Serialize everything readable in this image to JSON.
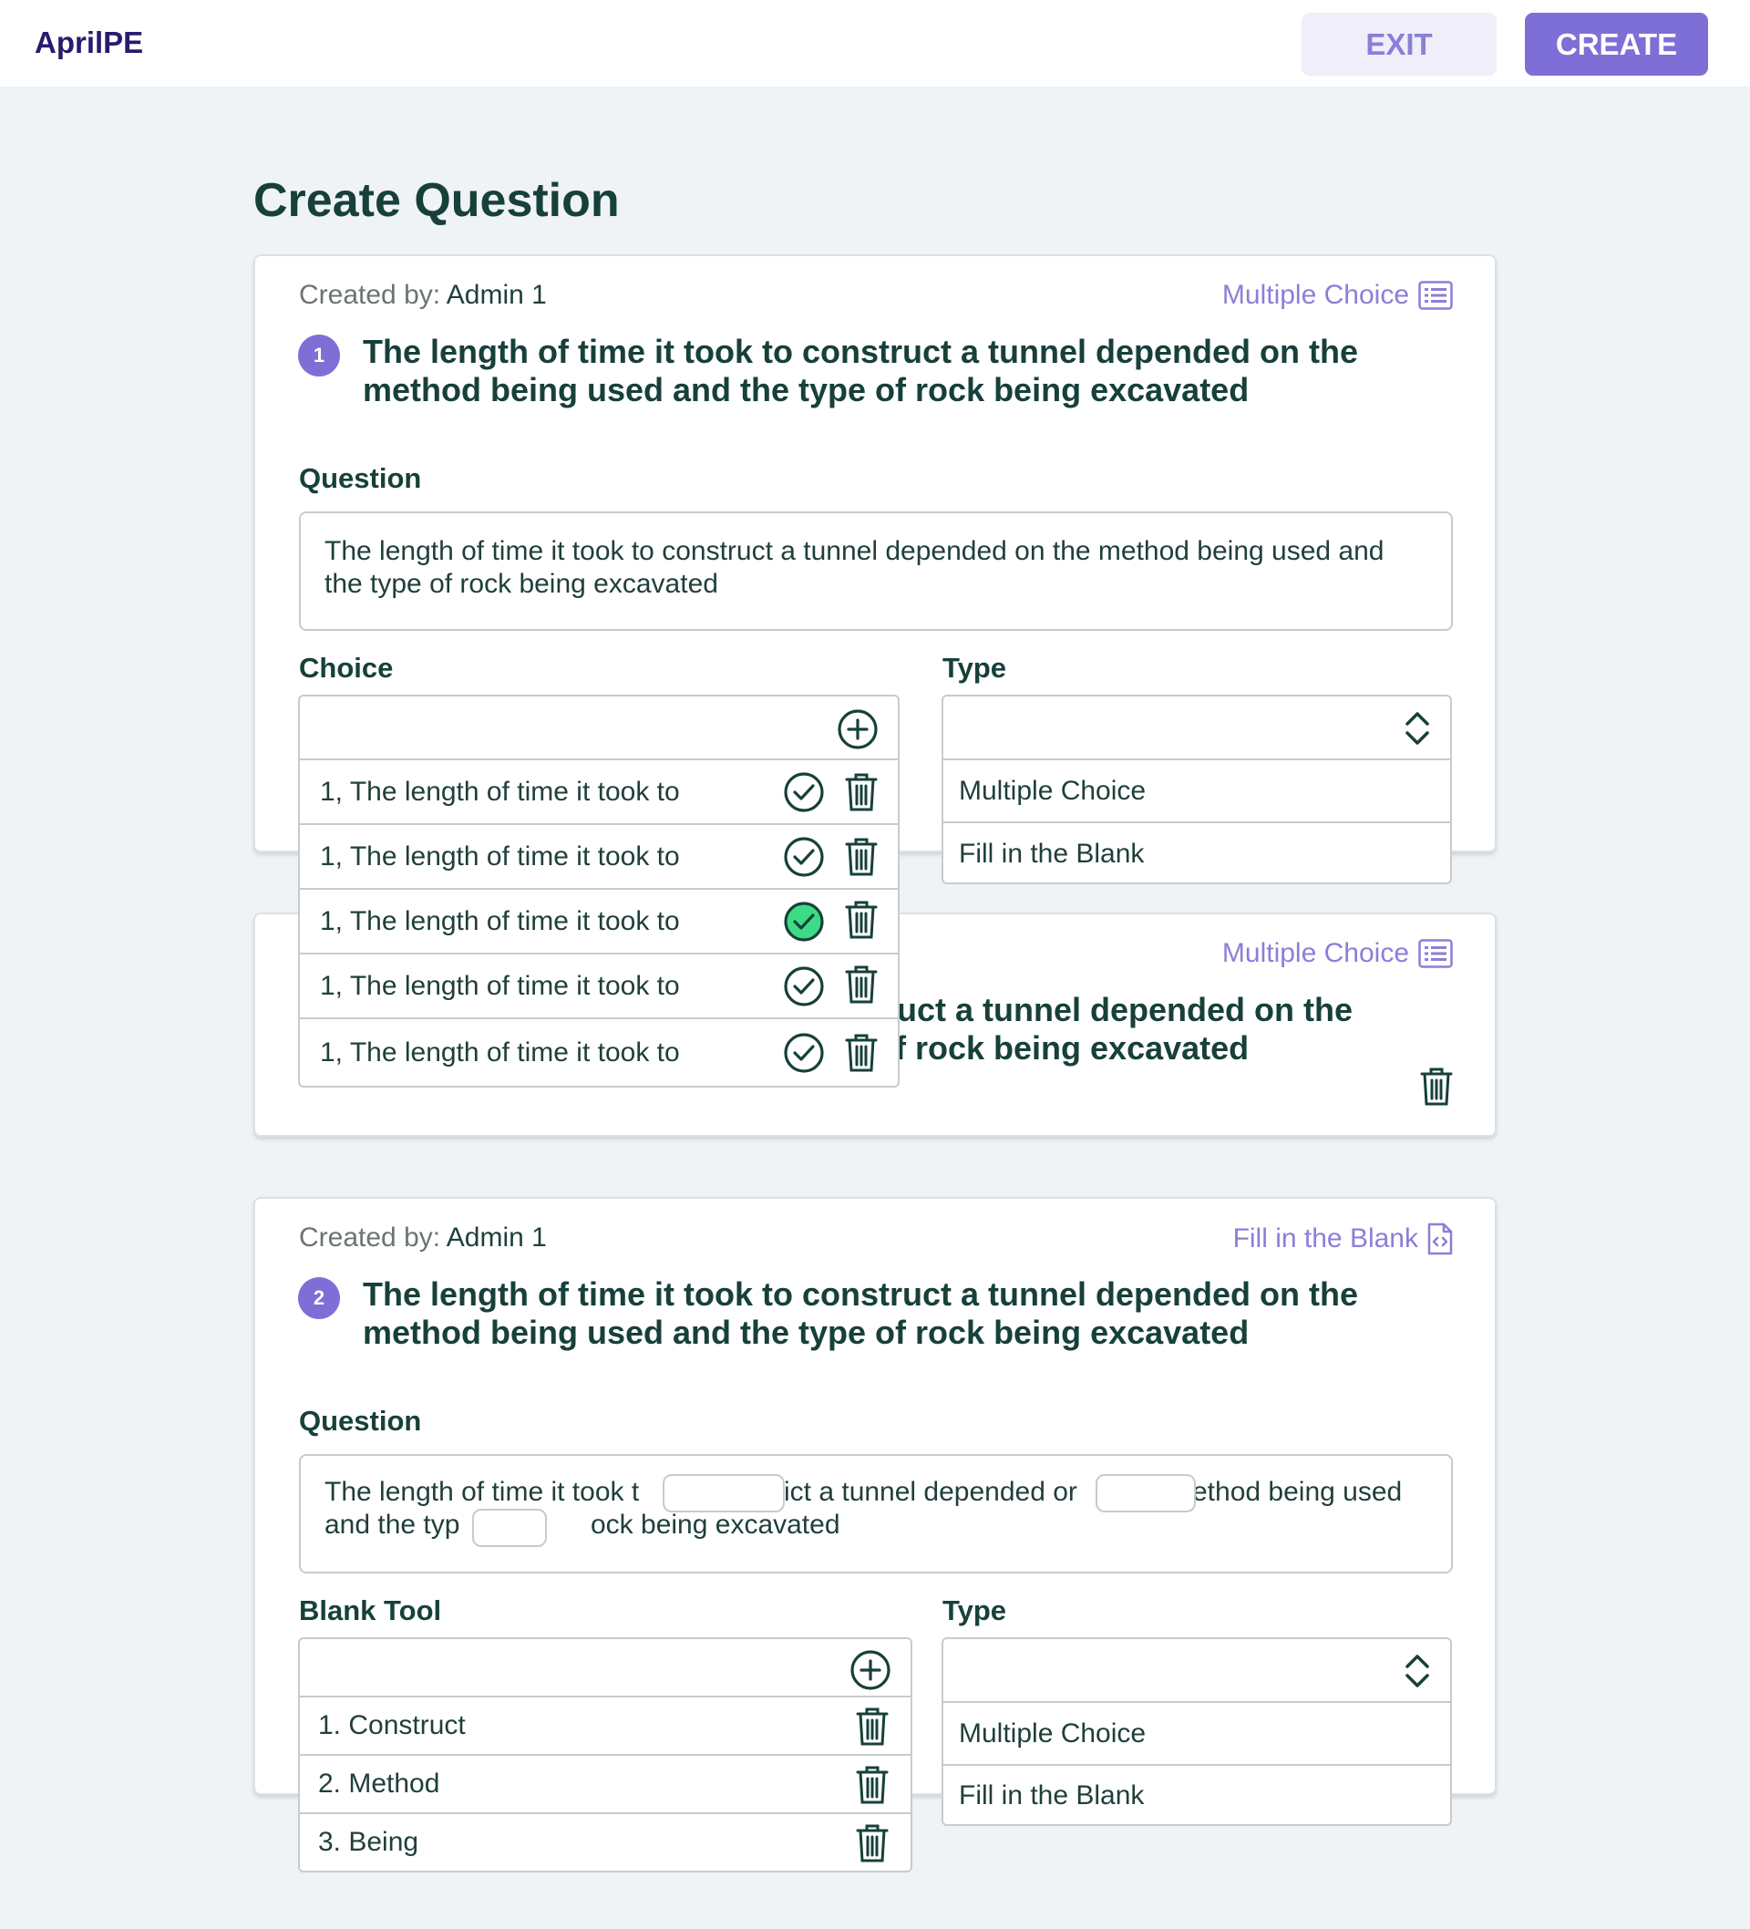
{
  "header": {
    "logo": "AprilPE",
    "exit_label": "EXIT",
    "create_label": "CREATE"
  },
  "page_title": "Create Question",
  "colors": {
    "accent": "#7e6fd6",
    "heading": "#17403a",
    "correct": "#3ddc84",
    "background": "#f0f3f6"
  },
  "cards": [
    {
      "created_by_label": "Created by:",
      "created_by_value": "Admin 1",
      "type_tag": "Multiple Choice",
      "type_icon": "list-icon",
      "number": "1",
      "title": "The length of time it took to construct a tunnel depended on the method being used and the type of rock being excavated",
      "question_label": "Question",
      "question_text": "The length of time it took to construct a tunnel depended on the method being used and the type of rock being excavated",
      "choice_label": "Choice",
      "type_label": "Type",
      "choices": [
        {
          "text": "1, The length of time it took to",
          "correct": false
        },
        {
          "text": "1, The length of time it took to",
          "correct": false
        },
        {
          "text": "1, The length of time it took to",
          "correct": true
        },
        {
          "text": "1, The length of time it took to",
          "correct": false
        },
        {
          "text": "1, The length of time it took to",
          "correct": false
        }
      ],
      "type_options": [
        "Multiple Choice",
        "Fill in the Blank"
      ]
    },
    {
      "type_tag": "Multiple Choice",
      "type_icon": "list-icon",
      "title_line1_visible": "uct a tunnel depended on the",
      "title_line2_visible": "f rock being excavated"
    },
    {
      "created_by_label": "Created by:",
      "created_by_value": "Admin 1",
      "type_tag": "Fill in the Blank",
      "type_icon": "code-file-icon",
      "number": "2",
      "title": "The length of time it took to construct a tunnel depended on the method being used and the type of rock being excavated",
      "question_label": "Question",
      "question_line1": [
        "The length of time it took t",
        "ict a tunnel depended or",
        "ethod being used"
      ],
      "question_line2": [
        "and the typ",
        "ock being excavated"
      ],
      "blank_tool_label": "Blank Tool",
      "type_label": "Type",
      "blanks": [
        "1. Construct",
        "2. Method",
        "3. Being"
      ],
      "type_options": [
        "Multiple Choice",
        "Fill in the Blank"
      ]
    }
  ]
}
